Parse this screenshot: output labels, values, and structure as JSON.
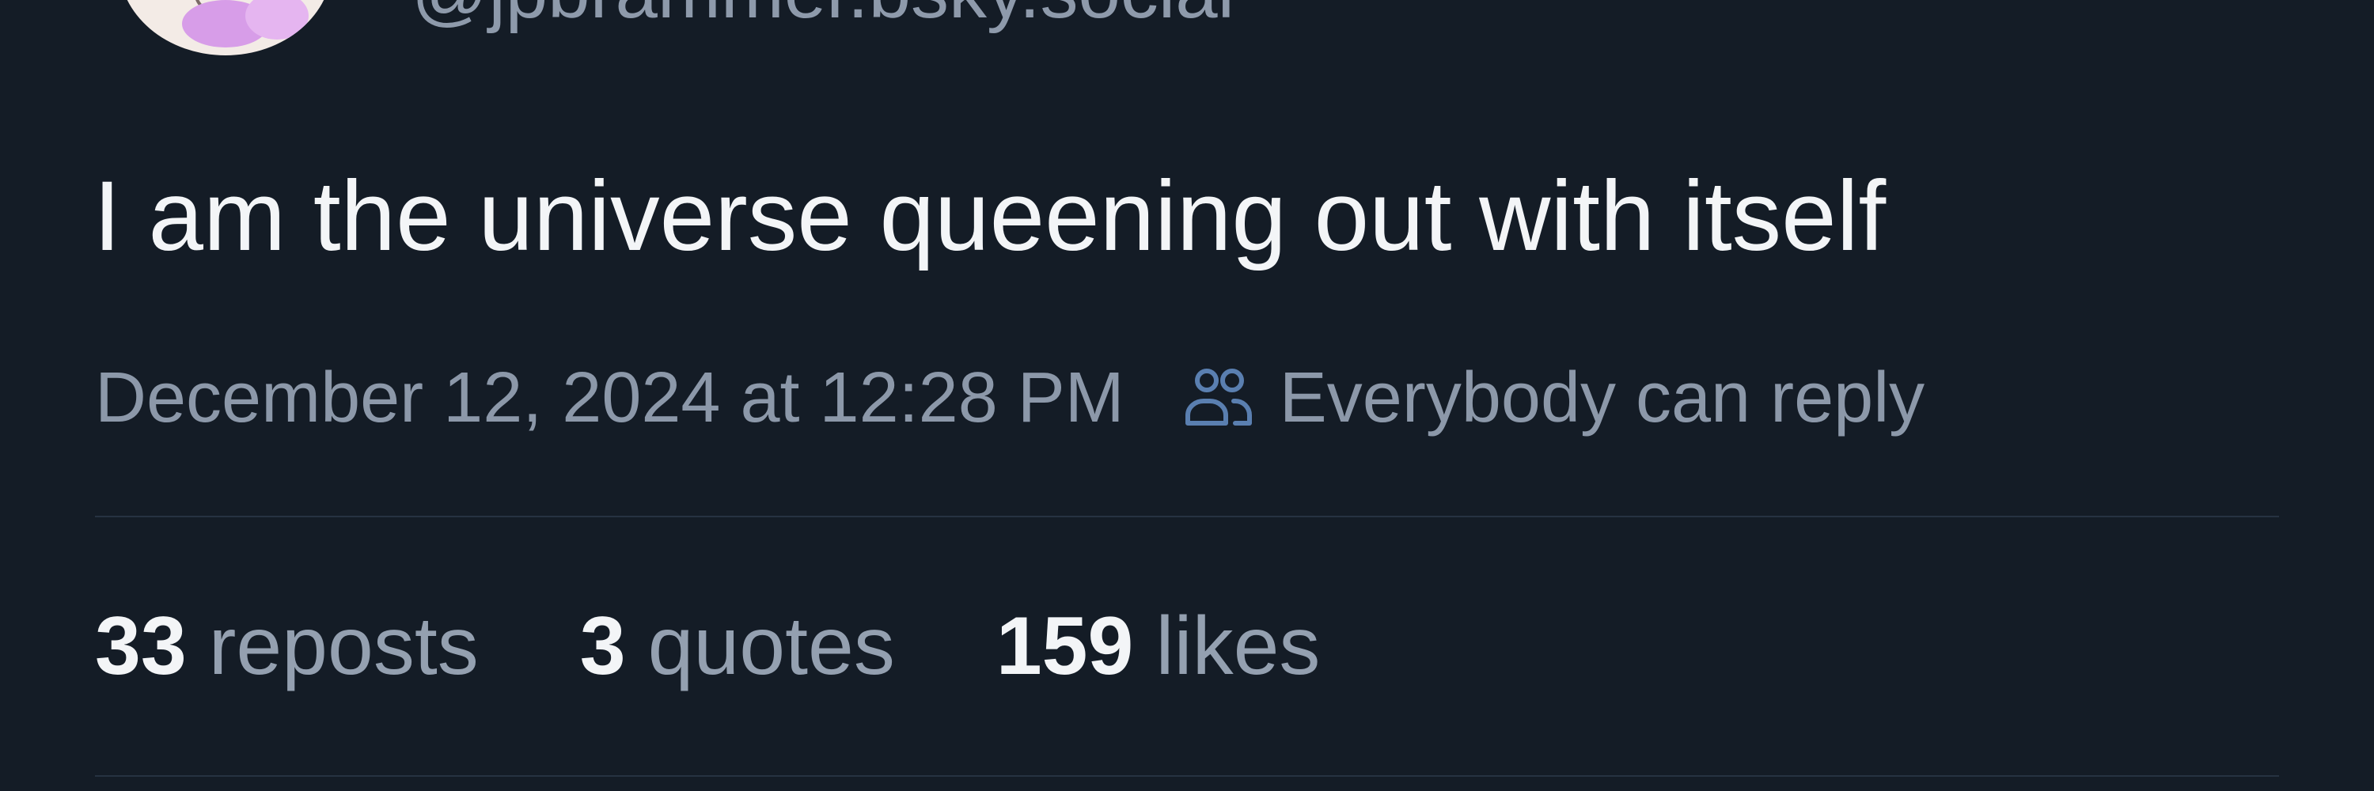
{
  "author": {
    "handle": "@jpbrammer.bsky.social"
  },
  "post": {
    "text": "I am the universe queening out with itself",
    "timestamp": "December 12, 2024 at 12:28 PM",
    "reply_setting": "Everybody can reply",
    "reply_icon": "people-icon"
  },
  "stats": {
    "reposts_count": "33",
    "reposts_label": "reposts",
    "quotes_count": "3",
    "quotes_label": "quotes",
    "likes_count": "159",
    "likes_label": "likes"
  },
  "colors": {
    "background": "#141c26",
    "text_primary": "#f3f5f7",
    "text_secondary": "#8c98a9",
    "accent_icon": "#5a7fb0",
    "divider": "#263241"
  }
}
